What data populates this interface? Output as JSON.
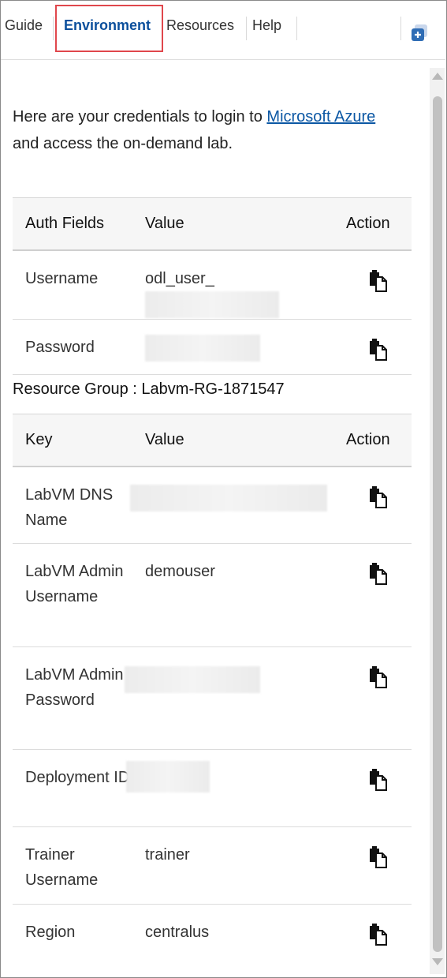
{
  "tabs": [
    {
      "label": "Guide"
    },
    {
      "label": "Environment",
      "active": true
    },
    {
      "label": "Resources"
    },
    {
      "label": "Help"
    }
  ],
  "intro": {
    "text_before": "Here are your credentials to login to ",
    "link": "Microsoft Azure",
    "text_after": "and access the on-demand lab."
  },
  "auth_table": {
    "headers": [
      "Auth Fields",
      "Value",
      "Action"
    ],
    "rows": [
      {
        "field": "Username",
        "value": "odl_user_"
      },
      {
        "field": "Password",
        "value": ""
      }
    ]
  },
  "resource_group": {
    "label": "Resource Group : Labvm-RG-1871547"
  },
  "resource_table": {
    "headers": [
      "Key",
      "Value",
      "Action"
    ],
    "rows": [
      {
        "key": "LabVM DNS Name",
        "value": ""
      },
      {
        "key": "LabVM Admin Username",
        "value": "demouser"
      },
      {
        "key": "LabVM Admin Password",
        "value": ""
      },
      {
        "key": "Deployment ID",
        "value": ""
      },
      {
        "key": "Trainer Username",
        "value": "trainer"
      },
      {
        "key": "Region",
        "value": "centralus"
      }
    ]
  },
  "icons": {
    "copy": "copy-icon",
    "extension": "add-panel-icon"
  },
  "colors": {
    "active_tab": "#0b4f9c",
    "highlight_border": "#e0474c",
    "link": "#0b57a4"
  }
}
